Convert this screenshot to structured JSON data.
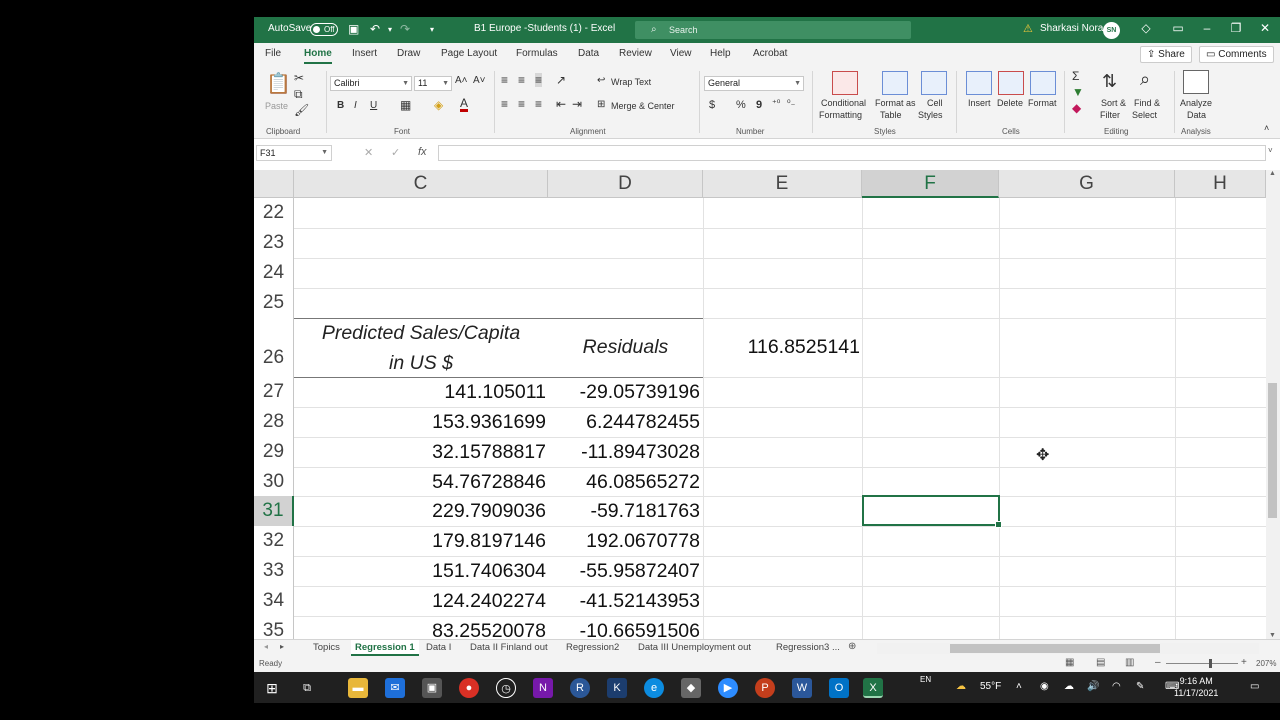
{
  "titlebar": {
    "autosave_label": "AutoSave",
    "autosave_state": "Off",
    "doc_title": "B1 Europe -Students (1)  -  Excel",
    "search_placeholder": "Search",
    "user_name": "Sharkasi Nora",
    "user_initials": "SN"
  },
  "tabs": [
    "File",
    "Home",
    "Insert",
    "Draw",
    "Page Layout",
    "Formulas",
    "Data",
    "Review",
    "View",
    "Help",
    "Acrobat"
  ],
  "active_tab": "Home",
  "share_label": "Share",
  "comments_label": "Comments",
  "ribbon": {
    "clipboard": {
      "label": "Clipboard",
      "paste": "Paste"
    },
    "font": {
      "label": "Font",
      "name": "Calibri",
      "size": "11",
      "bold": "B",
      "italic": "I",
      "underline": "U"
    },
    "alignment": {
      "label": "Alignment",
      "wrap": "Wrap Text",
      "merge": "Merge & Center"
    },
    "number": {
      "label": "Number",
      "format": "General",
      "currency": "$",
      "percent": "%",
      "comma": "9"
    },
    "styles": {
      "label": "Styles",
      "conditional": "Conditional",
      "conditional2": "Formatting",
      "format_table": "Format as",
      "format_table2": "Table",
      "cell_styles": "Cell",
      "cell_styles2": "Styles"
    },
    "cells": {
      "label": "Cells",
      "insert": "Insert",
      "delete": "Delete",
      "format": "Format"
    },
    "editing": {
      "label": "Editing",
      "sort": "Sort &",
      "sort2": "Filter",
      "find": "Find &",
      "find2": "Select"
    },
    "analysis": {
      "label": "Analysis",
      "analyze": "Analyze",
      "analyze2": "Data"
    }
  },
  "formula_bar": {
    "name_box": "F31",
    "fx": "fx",
    "value": ""
  },
  "columns": [
    "C",
    "D",
    "E",
    "F",
    "G",
    "H"
  ],
  "selected_column": "F",
  "rows": [
    "22",
    "23",
    "24",
    "25",
    "26",
    "27",
    "28",
    "29",
    "30",
    "31",
    "32",
    "33",
    "34",
    "35"
  ],
  "selected_row": "31",
  "header_row": {
    "c_line1": "Predicted Sales/Capita",
    "c_line2": "in US $",
    "d": "Residuals",
    "e": "116.8525141"
  },
  "data_rows": [
    {
      "c": "141.105011",
      "d": "-29.05739196"
    },
    {
      "c": "153.9361699",
      "d": "6.244782455"
    },
    {
      "c": "32.15788817",
      "d": "-11.89473028"
    },
    {
      "c": "54.76728846",
      "d": "46.08565272"
    },
    {
      "c": "229.7909036",
      "d": "-59.7181763"
    },
    {
      "c": "179.8197146",
      "d": "192.0670778"
    },
    {
      "c": "151.7406304",
      "d": "-55.95872407"
    },
    {
      "c": "124.2402274",
      "d": "-41.52143953"
    },
    {
      "c": "83.25520078",
      "d": "-10.66591506"
    }
  ],
  "sheets": [
    "Topics",
    "Regression 1",
    "Data I",
    "Data II Finland out",
    "Regression2",
    "Data III Unemployment out",
    "Regression3 ..."
  ],
  "active_sheet": "Regression 1",
  "status": {
    "ready": "Ready",
    "zoom": "207%"
  },
  "taskbar": {
    "weather": "55°F",
    "lang": "EN",
    "time": "9:16 AM",
    "date": "11/17/2021"
  },
  "colors": {
    "excel_green": "#217346",
    "taskbar": "#202020"
  }
}
